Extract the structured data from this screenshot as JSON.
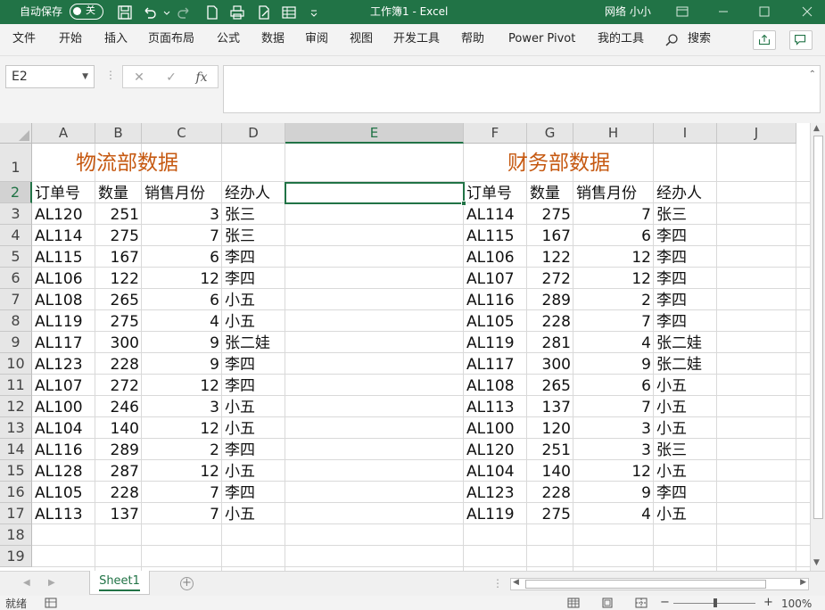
{
  "titlebar": {
    "autosave_label": "自动保存",
    "autosave_state": "关",
    "title": "工作簿1  -  Excel",
    "user": "网络 小小"
  },
  "ribbon": {
    "tabs": [
      "文件",
      "开始",
      "插入",
      "页面布局",
      "公式",
      "数据",
      "审阅",
      "视图",
      "开发工具",
      "帮助",
      "Power Pivot",
      "我的工具",
      "搜索"
    ]
  },
  "formula_bar": {
    "name_box": "E2",
    "fx": "fx",
    "value": ""
  },
  "sheet": {
    "columns": [
      "A",
      "B",
      "C",
      "D",
      "E",
      "F",
      "G",
      "H",
      "I",
      "J"
    ],
    "selected_column": "E",
    "selected_row": "2",
    "rows": [
      "1",
      "2",
      "3",
      "4",
      "5",
      "6",
      "7",
      "8",
      "9",
      "10",
      "11",
      "12",
      "13",
      "14",
      "15",
      "16",
      "17",
      "18",
      "19"
    ],
    "left_title": "物流部数据",
    "right_title": "财务部数据",
    "headers": [
      "订单号",
      "数量",
      "销售月份",
      "经办人"
    ],
    "left_table": [
      [
        "AL120",
        "251",
        "3",
        "张三"
      ],
      [
        "AL114",
        "275",
        "7",
        "张三"
      ],
      [
        "AL115",
        "167",
        "6",
        "李四"
      ],
      [
        "AL106",
        "122",
        "12",
        "李四"
      ],
      [
        "AL108",
        "265",
        "6",
        "小五"
      ],
      [
        "AL119",
        "275",
        "4",
        "小五"
      ],
      [
        "AL117",
        "300",
        "9",
        "张二娃"
      ],
      [
        "AL123",
        "228",
        "9",
        "李四"
      ],
      [
        "AL107",
        "272",
        "12",
        "李四"
      ],
      [
        "AL100",
        "246",
        "3",
        "小五"
      ],
      [
        "AL104",
        "140",
        "12",
        "小五"
      ],
      [
        "AL116",
        "289",
        "2",
        "李四"
      ],
      [
        "AL128",
        "287",
        "12",
        "小五"
      ],
      [
        "AL105",
        "228",
        "7",
        "李四"
      ],
      [
        "AL113",
        "137",
        "7",
        "小五"
      ]
    ],
    "right_table": [
      [
        "AL114",
        "275",
        "7",
        "张三"
      ],
      [
        "AL115",
        "167",
        "6",
        "李四"
      ],
      [
        "AL106",
        "122",
        "12",
        "李四"
      ],
      [
        "AL107",
        "272",
        "12",
        "李四"
      ],
      [
        "AL116",
        "289",
        "2",
        "李四"
      ],
      [
        "AL105",
        "228",
        "7",
        "李四"
      ],
      [
        "AL119",
        "281",
        "4",
        "张二娃"
      ],
      [
        "AL117",
        "300",
        "9",
        "张二娃"
      ],
      [
        "AL108",
        "265",
        "6",
        "小五"
      ],
      [
        "AL113",
        "137",
        "7",
        "小五"
      ],
      [
        "AL100",
        "120",
        "3",
        "小五"
      ],
      [
        "AL120",
        "251",
        "3",
        "张三"
      ],
      [
        "AL104",
        "140",
        "12",
        "小五"
      ],
      [
        "AL123",
        "228",
        "9",
        "李四"
      ],
      [
        "AL119",
        "275",
        "4",
        "小五"
      ]
    ]
  },
  "sheet_tabs": {
    "active": "Sheet1"
  },
  "status": {
    "ready": "就绪",
    "zoom": "100%"
  },
  "colors": {
    "brand": "#217346",
    "title_accent": "#c65911"
  }
}
